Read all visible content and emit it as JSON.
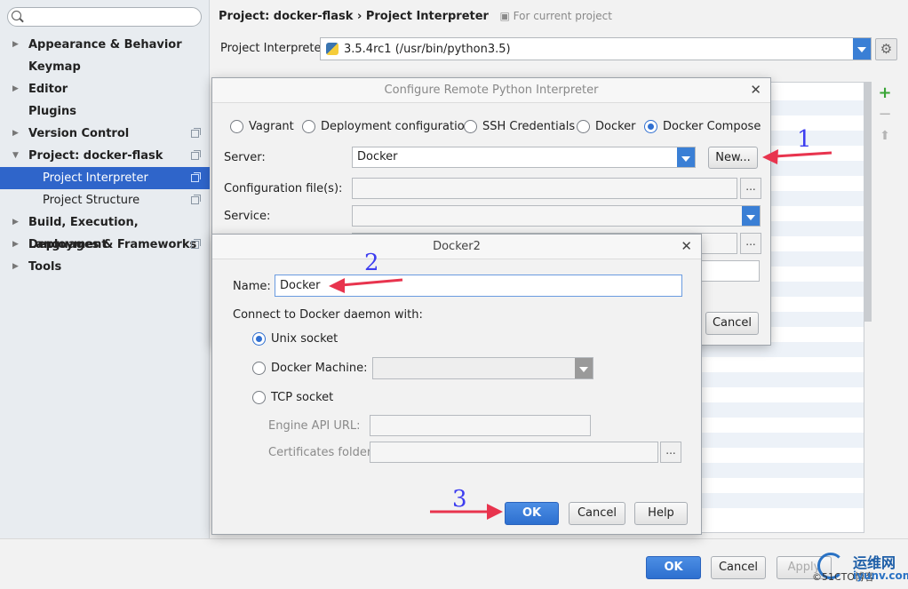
{
  "sidebar": {
    "search_placeholder": "",
    "items": [
      {
        "label": "Appearance & Behavior"
      },
      {
        "label": "Keymap"
      },
      {
        "label": "Editor"
      },
      {
        "label": "Plugins"
      },
      {
        "label": "Version Control"
      },
      {
        "label": "Project: docker-flask"
      },
      {
        "label": "Project Interpreter"
      },
      {
        "label": "Project Structure"
      },
      {
        "label": "Build, Execution, Deployment"
      },
      {
        "label": "Languages & Frameworks"
      },
      {
        "label": "Tools"
      }
    ]
  },
  "header": {
    "breadcrumb": "Project: docker-flask › Project Interpreter",
    "for_current": "For current project"
  },
  "interpreter": {
    "label": "Project Interpreter:",
    "value": "3.5.4rc1 (/usr/bin/python3.5)"
  },
  "bottom_buttons": {
    "ok": "OK",
    "cancel": "Cancel",
    "apply": "Apply"
  },
  "configure_dialog": {
    "title": "Configure Remote Python Interpreter",
    "radios": [
      {
        "label": "Vagrant",
        "checked": false
      },
      {
        "label": "Deployment configuration",
        "checked": false
      },
      {
        "label": "SSH Credentials",
        "checked": false
      },
      {
        "label": "Docker",
        "checked": false
      },
      {
        "label": "Docker Compose",
        "checked": true
      }
    ],
    "server_label": "Server:",
    "server_value": "Docker",
    "new_button": "New...",
    "config_files_label": "Configuration file(s):",
    "service_label": "Service:",
    "ellipsis": "...",
    "cancel": "Cancel"
  },
  "docker_dialog": {
    "title": "Docker2",
    "name_label": "Name:",
    "name_value": "Docker",
    "connect_label": "Connect to Docker daemon with:",
    "unix_socket": "Unix socket",
    "docker_machine": "Docker Machine:",
    "tcp_socket": "TCP socket",
    "engine_api_url": "Engine API URL:",
    "certificates_folder": "Certificates folder:",
    "ellipsis": "...",
    "ok": "OK",
    "cancel": "Cancel",
    "help": "Help"
  },
  "annotations": {
    "step1": "1",
    "step2": "2",
    "step3": "3"
  },
  "watermark": {
    "text": "运维网",
    "url": "iyunv.com",
    "prefix": "©51CTO博客"
  },
  "colors": {
    "selection": "#2f65ca",
    "accent": "#3a7fd5",
    "arrow": "#e8344e",
    "annotation": "#3d3df0"
  }
}
